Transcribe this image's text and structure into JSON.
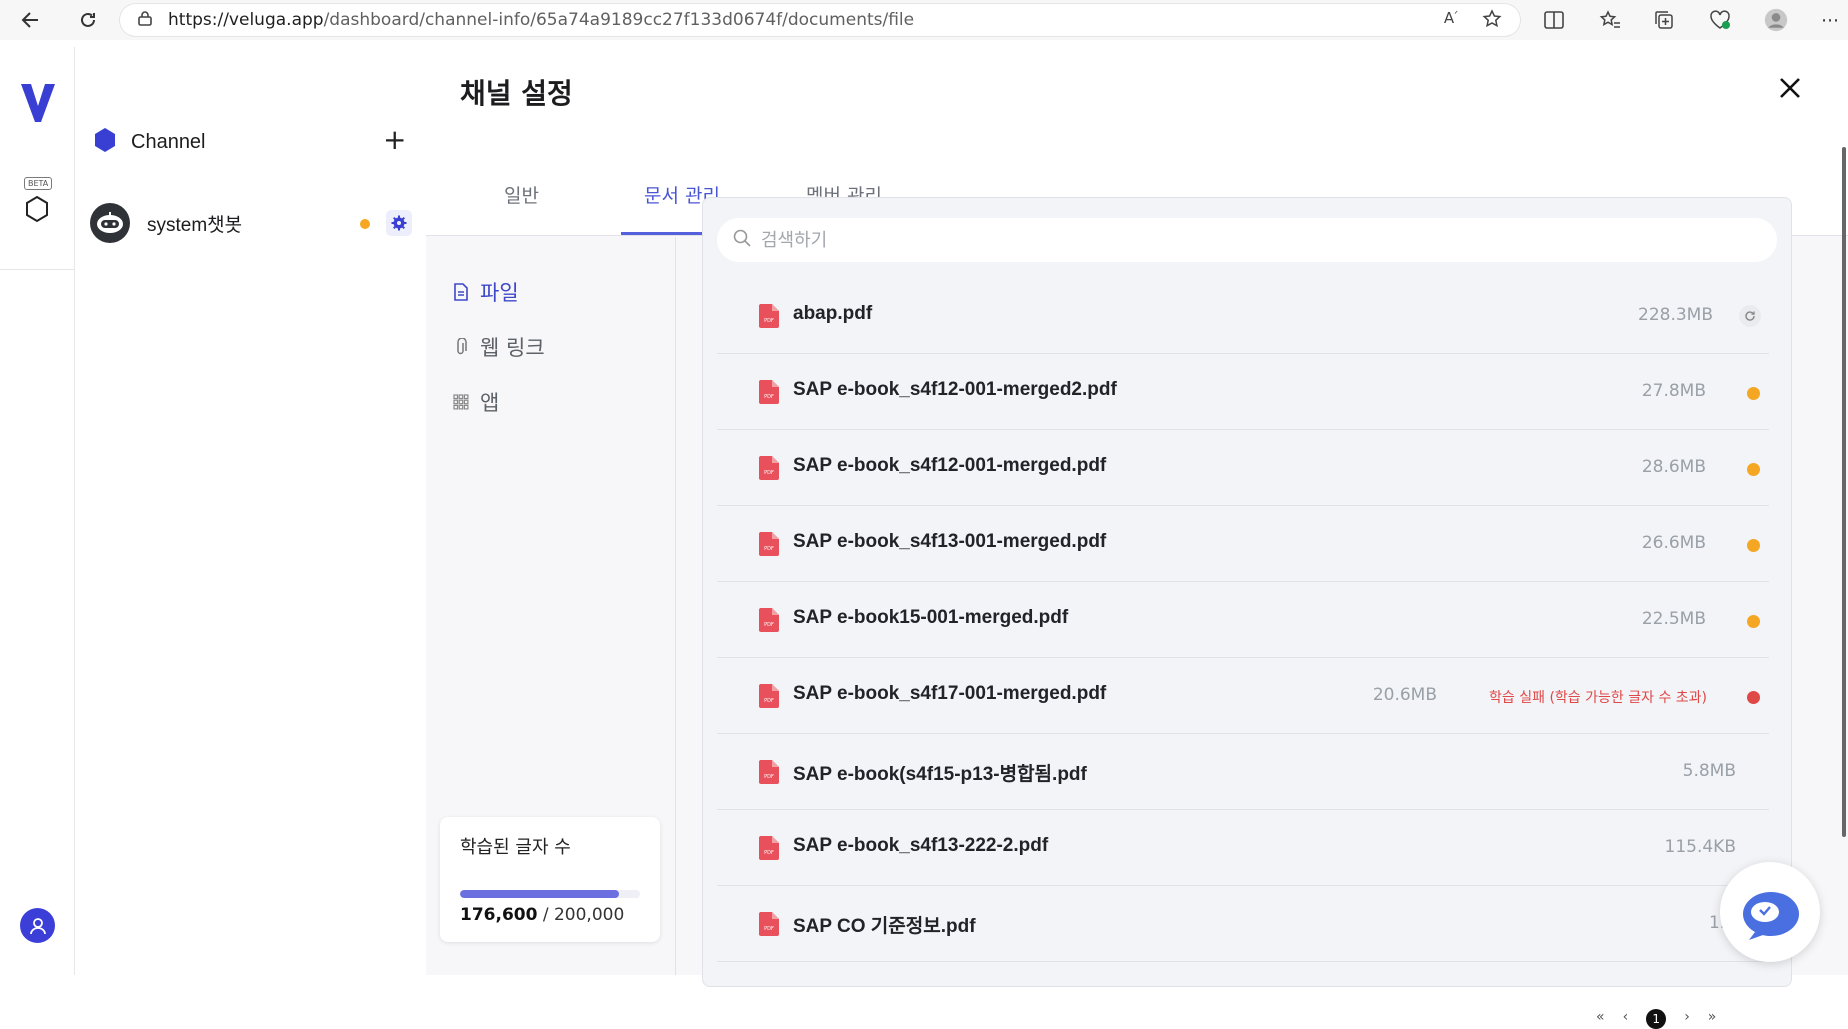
{
  "browser": {
    "url_host": "https://veluga.app",
    "url_path": "/dashboard/channel-info/65a74a9189cc27f133d0674f/documents/file"
  },
  "rail": {
    "beta_label": "BETA"
  },
  "sidebar": {
    "channel_title": "Channel",
    "add_label": "+",
    "bot_name": "system챗봇"
  },
  "modal": {
    "title": "채널 설정",
    "tabs": [
      {
        "label": "일반"
      },
      {
        "label": "문서 관리"
      },
      {
        "label": "멤버 관리"
      }
    ],
    "subnav": [
      {
        "label": "파일"
      },
      {
        "label": "웹 링크"
      },
      {
        "label": "앱"
      }
    ],
    "usage": {
      "title": "학습된 글자 수",
      "used": "176,600",
      "total": "200,000",
      "fraction": 0.883
    },
    "search": {
      "placeholder": "검색하기"
    },
    "files": [
      {
        "name": "abap.pdf",
        "size": "228.3MB",
        "status": "processing"
      },
      {
        "name": "SAP e-book_s4f12-001-merged2.pdf",
        "size": "27.8MB",
        "status": "pending"
      },
      {
        "name": "SAP e-book_s4f12-001-merged.pdf",
        "size": "28.6MB",
        "status": "pending"
      },
      {
        "name": "SAP e-book_s4f13-001-merged.pdf",
        "size": "26.6MB",
        "status": "pending"
      },
      {
        "name": "SAP e-book15-001-merged.pdf",
        "size": "22.5MB",
        "status": "pending"
      },
      {
        "name": "SAP e-book_s4f17-001-merged.pdf",
        "size": "20.6MB",
        "status": "error",
        "error_text": "학습 실패 (학습 가능한 글자 수 초과)"
      },
      {
        "name": "SAP e-book(s4f15-p13-병합됨.pdf",
        "size": "5.8MB",
        "status": "done"
      },
      {
        "name": "SAP e-book_s4f13-222-2.pdf",
        "size": "115.4KB",
        "status": "done"
      },
      {
        "name": "SAP CO 기준정보.pdf",
        "size": "1.5",
        "status": "done"
      }
    ],
    "pager": {
      "current": "1"
    }
  },
  "colors": {
    "accent": "#4a55d6",
    "pending": "#f5a623",
    "error": "#e04848",
    "file_icon": "#e8505b"
  }
}
